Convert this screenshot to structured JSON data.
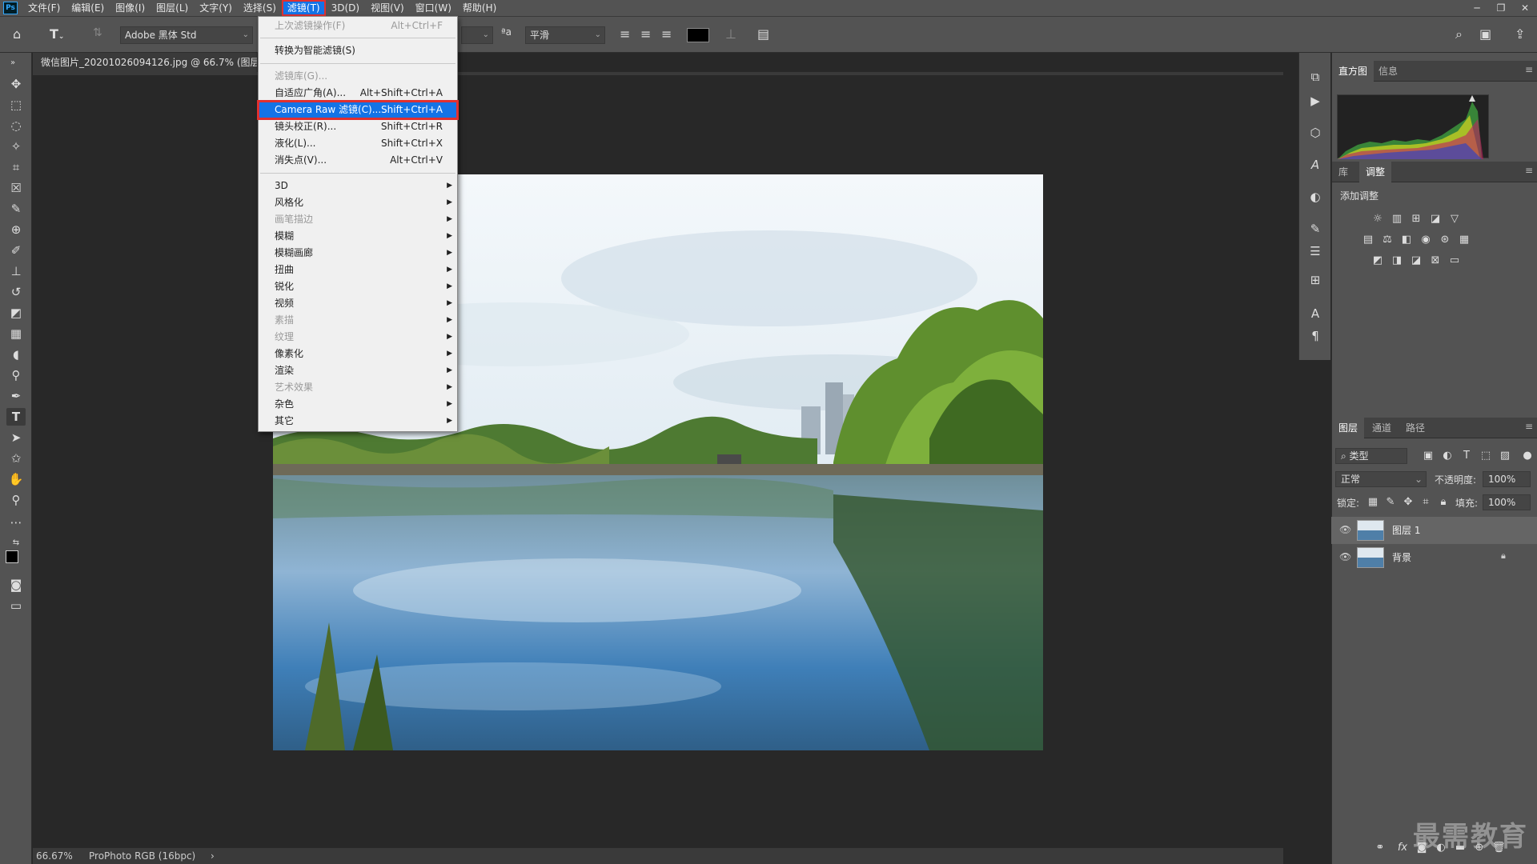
{
  "menubar": {
    "logo": "Ps",
    "items": [
      "文件(F)",
      "编辑(E)",
      "图像(I)",
      "图层(L)",
      "文字(Y)",
      "选择(S)",
      "滤镜(T)",
      "3D(D)",
      "视图(V)",
      "窗口(W)",
      "帮助(H)"
    ],
    "active_index": 6,
    "win": {
      "minimize": "─",
      "restore": "❐",
      "close": "✕"
    }
  },
  "options": {
    "font_family": "Adobe 黑体 Std",
    "aa_label": "ªa",
    "anti_alias": "平滑"
  },
  "document": {
    "tab_title": "微信图片_20201026094126.jpg @ 66.7% (图层",
    "zoom": "66.67%",
    "color_profile": "ProPhoto RGB (16bpc)",
    "status_arrow": "›"
  },
  "filter_menu": {
    "last_filter": {
      "label": "上次滤镜操作(F)",
      "shortcut": "Alt+Ctrl+F"
    },
    "smart": {
      "label": "转换为智能滤镜(S)"
    },
    "gallery": {
      "label": "滤镜库(G)..."
    },
    "adaptive": {
      "label": "自适应广角(A)...",
      "shortcut": "Alt+Shift+Ctrl+A"
    },
    "camera_raw": {
      "label": "Camera Raw 滤镜(C)...",
      "shortcut": "Shift+Ctrl+A"
    },
    "lens": {
      "label": "镜头校正(R)...",
      "shortcut": "Shift+Ctrl+R"
    },
    "liquify": {
      "label": "液化(L)...",
      "shortcut": "Shift+Ctrl+X"
    },
    "vanish": {
      "label": "消失点(V)...",
      "shortcut": "Alt+Ctrl+V"
    },
    "submenus": [
      "3D",
      "风格化",
      "画笔描边",
      "模糊",
      "模糊画廊",
      "扭曲",
      "锐化",
      "视频",
      "素描",
      "纹理",
      "像素化",
      "渲染",
      "艺术效果",
      "杂色",
      "其它"
    ]
  },
  "histogram_panel": {
    "tabs": [
      "直方图",
      "信息"
    ]
  },
  "adjust_panel": {
    "tabs": [
      "库",
      "调整"
    ],
    "title": "添加调整"
  },
  "layers_panel": {
    "tabs": [
      "图层",
      "通道",
      "路径"
    ],
    "filter_label": "类型",
    "blend_mode": "正常",
    "opacity_label": "不透明度:",
    "opacity": "100%",
    "lock_label": "锁定:",
    "fill_label": "填充:",
    "fill": "100%",
    "layers": [
      {
        "name": "图层 1"
      },
      {
        "name": "背景"
      }
    ]
  },
  "watermark": "最需教育"
}
